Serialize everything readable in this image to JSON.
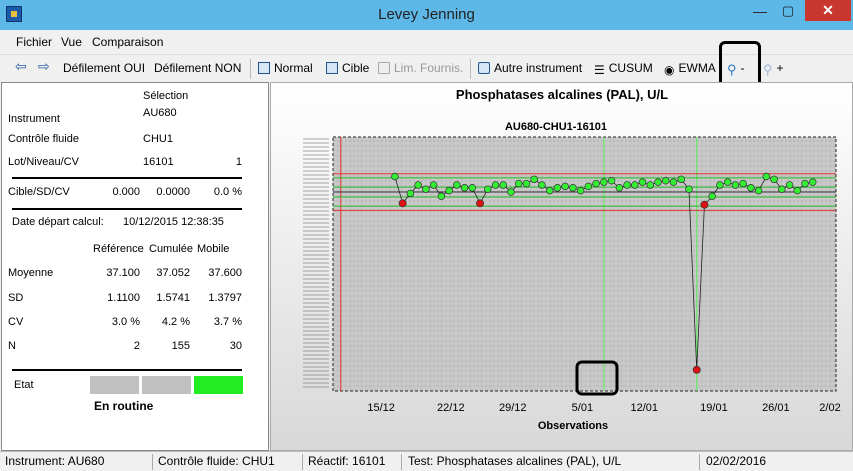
{
  "window": {
    "title": "Levey Jenning"
  },
  "menu": [
    "Fichier",
    "Vue",
    "Comparaison"
  ],
  "toolbar": {
    "scroll_yes": "Défilement OUI",
    "scroll_no": "Défilement NON",
    "normal": "Normal",
    "target": "Cible",
    "supplier_limits": "Lim. Fournis.",
    "other_instrument": "Autre instrument",
    "cusum": "CUSUM",
    "ewma": "EWMA",
    "zoom_out": "-",
    "zoom_in": "+"
  },
  "panel": {
    "selection_header": "Sélection",
    "instrument_label": "Instrument",
    "instrument_value": "AU680",
    "control_label": "Contrôle fluide",
    "control_value": "CHU1",
    "lot_label": "Lot/Niveau/CV",
    "lot_value": "16101",
    "level_value": "1",
    "target_label": "Cible/SD/CV",
    "target_values": [
      "0.000",
      "0.0000",
      "0.0 %"
    ],
    "start_date_label": "Date départ calcul:",
    "start_date_value": "10/12/2015 12:38:35",
    "columns": [
      "Référence",
      "Cumulée",
      "Mobile"
    ],
    "stats": [
      {
        "label": "Moyenne",
        "values": [
          "37.100",
          "37.052",
          "37.600"
        ]
      },
      {
        "label": "SD",
        "values": [
          "1.1100",
          "1.5741",
          "1.3797"
        ]
      },
      {
        "label": "CV",
        "values": [
          "3.0 %",
          "4.2 %",
          "3.7 %"
        ]
      },
      {
        "label": "N",
        "values": [
          "2",
          "155",
          "30"
        ]
      }
    ],
    "state_label": "Etat",
    "state_text": "En routine",
    "state_colors": [
      "#c0c0c0",
      "#c0c0c0",
      "#22ee22"
    ]
  },
  "chart_data": {
    "type": "scatter",
    "title": "Phosphatases alcalines (PAL), U/L",
    "subtitle": "AU680-CHU1-16101",
    "xlabel": "Observations",
    "x_ticks": [
      "15/12",
      "22/12",
      "29/12",
      "5/01",
      "12/01",
      "19/01",
      "26/01",
      "2/02"
    ],
    "x": [
      9,
      10,
      11,
      12,
      13,
      14,
      15,
      16,
      17,
      18,
      19,
      20,
      21,
      22,
      23,
      24,
      25,
      26,
      27,
      28,
      29,
      30,
      31,
      32,
      33,
      34,
      35,
      36,
      37,
      38,
      39,
      40,
      41,
      42,
      43,
      44,
      45,
      46,
      47,
      48,
      49,
      50,
      51,
      52,
      53,
      54,
      55,
      56,
      57,
      58,
      59,
      60,
      61,
      62,
      63
    ],
    "y": [
      38.2,
      36.3,
      37.0,
      37.6,
      37.3,
      37.6,
      36.8,
      37.2,
      37.6,
      37.4,
      37.4,
      36.3,
      37.3,
      37.6,
      37.6,
      37.1,
      37.7,
      37.7,
      38.0,
      37.6,
      37.2,
      37.4,
      37.5,
      37.4,
      37.2,
      37.5,
      37.7,
      37.8,
      37.9,
      37.4,
      37.6,
      37.6,
      37.8,
      37.6,
      37.8,
      37.9,
      37.8,
      38.0,
      37.3,
      24.5,
      36.2,
      36.8,
      37.6,
      37.8,
      37.6,
      37.7,
      37.4,
      37.2,
      38.2,
      38.0,
      37.3,
      37.6,
      37.2,
      37.7,
      37.8
    ],
    "out_of_control": [
      1,
      11,
      39,
      40
    ],
    "reference_mean": 37.1
  },
  "status": {
    "instrument": "Instrument: AU680",
    "control": "Contrôle fluide: CHU1",
    "reagent": "Réactif: 16101",
    "test": "Test: Phosphatases alcalines (PAL), U/L",
    "date": "02/02/2016"
  }
}
